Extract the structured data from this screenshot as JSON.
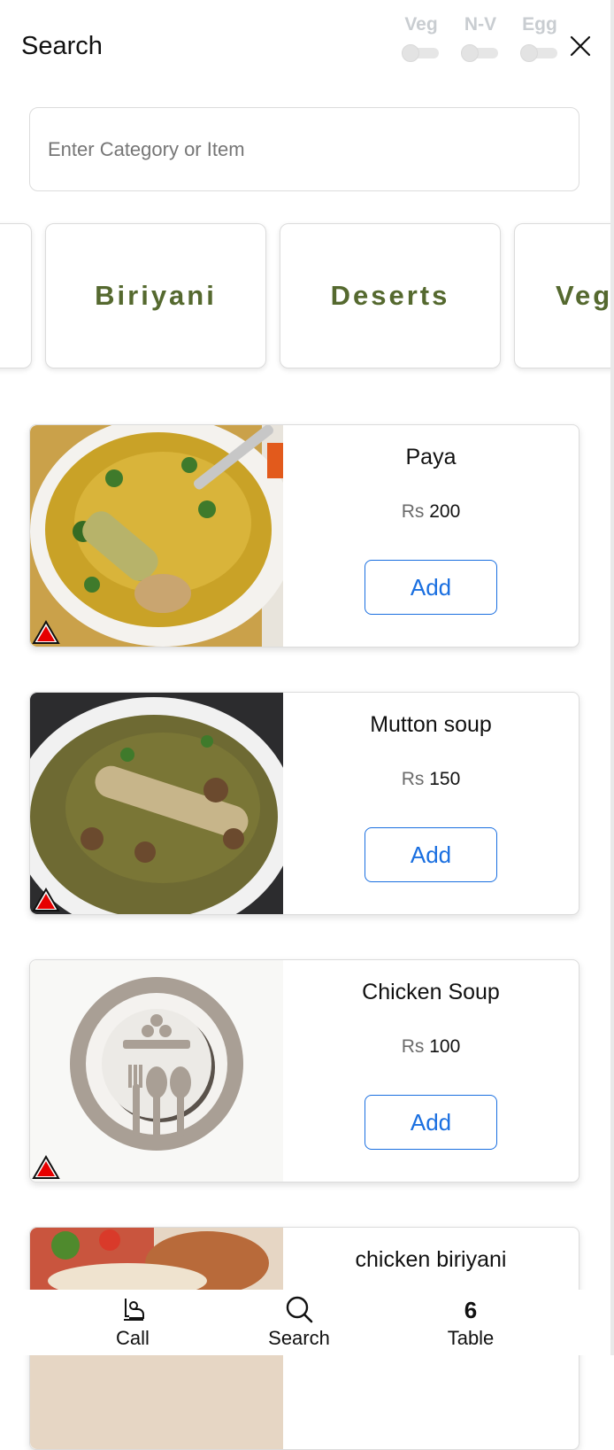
{
  "header": {
    "title": "Search",
    "filters": [
      {
        "label": "Veg"
      },
      {
        "label": "N-V"
      },
      {
        "label": "Egg"
      }
    ],
    "close_icon": "close-icon"
  },
  "search": {
    "placeholder": "Enter Category or Item",
    "value": ""
  },
  "categories": [
    {
      "label": ""
    },
    {
      "label": "Biriyani"
    },
    {
      "label": "Deserts"
    },
    {
      "label": "Veg"
    }
  ],
  "items": [
    {
      "name": "Paya",
      "currency": "Rs",
      "price": "200",
      "add_label": "Add",
      "image_icon": "soup-photo"
    },
    {
      "name": "Mutton soup",
      "currency": "Rs",
      "price": "150",
      "add_label": "Add",
      "image_icon": "soup-photo"
    },
    {
      "name": "Chicken Soup",
      "currency": "Rs",
      "price": "100",
      "add_label": "Add",
      "image_icon": "placeholder-plate-icon"
    },
    {
      "name": "chicken biriyani",
      "image_icon": "food-photo"
    }
  ],
  "bottom_nav": {
    "call": {
      "label": "Call",
      "icon": "waiter-icon"
    },
    "search": {
      "label": "Search",
      "icon": "search-icon"
    },
    "table": {
      "label": "Table",
      "number": "6"
    }
  },
  "colors": {
    "accent_blue": "#1a6fe0",
    "category_text": "#55692f",
    "non_veg_badge": "#e60000"
  }
}
